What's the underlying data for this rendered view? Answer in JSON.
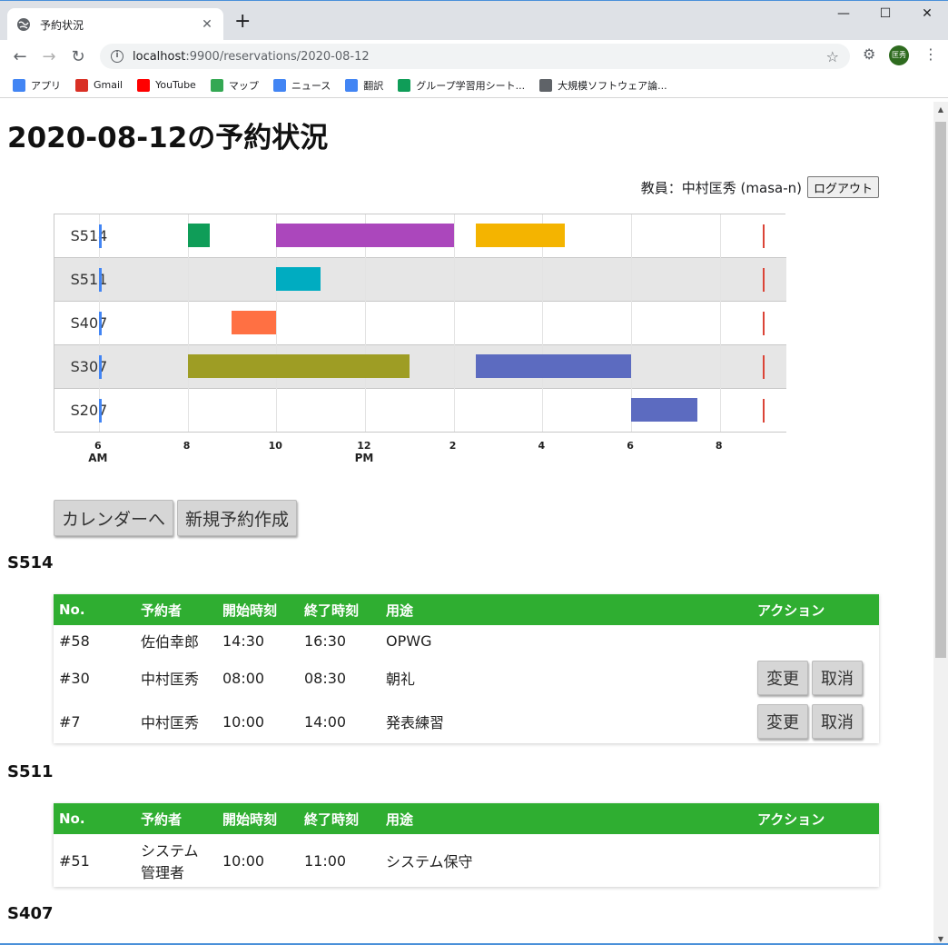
{
  "browser": {
    "tab_title": "予約状況",
    "tab_close": "✕",
    "new_tab": "+",
    "url_host": "localhost",
    "url_path": ":9900/reservations/2020-08-12",
    "avatar_text": "匡秀",
    "bookmarks": [
      {
        "label": "アプリ",
        "icon": "apps-grid-icon",
        "color": "#4285f4"
      },
      {
        "label": "Gmail",
        "icon": "gmail-icon",
        "color": "#d93025"
      },
      {
        "label": "YouTube",
        "icon": "youtube-icon",
        "color": "#ff0000"
      },
      {
        "label": "マップ",
        "icon": "maps-icon",
        "color": "#34a853"
      },
      {
        "label": "ニュース",
        "icon": "news-icon",
        "color": "#4285f4"
      },
      {
        "label": "翻訳",
        "icon": "translate-icon",
        "color": "#4285f4"
      },
      {
        "label": "グループ学習用シート...",
        "icon": "sheets-icon",
        "color": "#0f9d58"
      },
      {
        "label": "大規模ソフトウェア論...",
        "icon": "globe-icon",
        "color": "#5f6368"
      }
    ]
  },
  "page": {
    "title": "2020-08-12の予約状況",
    "user_label": "教員：",
    "user_name": "中村匡秀 (masa-n)",
    "logout": "ログアウト",
    "buttons": {
      "calendar": "カレンダーへ",
      "new_reservation": "新規予約作成"
    }
  },
  "timeline": {
    "type": "timeline",
    "x_range_hours": [
      5.0,
      21.5
    ],
    "rows": [
      {
        "room": "S514",
        "bars": [
          {
            "start": 8.0,
            "end": 8.5,
            "color": "#0f9d58"
          },
          {
            "start": 10.0,
            "end": 14.0,
            "color": "#ab47bc"
          },
          {
            "start": 14.5,
            "end": 16.5,
            "color": "#f4b400"
          }
        ]
      },
      {
        "room": "S511",
        "bars": [
          {
            "start": 10.0,
            "end": 11.0,
            "color": "#00acc1"
          }
        ]
      },
      {
        "room": "S407",
        "bars": [
          {
            "start": 9.0,
            "end": 10.0,
            "color": "#ff7043"
          }
        ]
      },
      {
        "room": "S307",
        "bars": [
          {
            "start": 8.0,
            "end": 13.0,
            "color": "#9e9d24"
          },
          {
            "start": 14.5,
            "end": 18.0,
            "color": "#5c6bc0"
          }
        ]
      },
      {
        "room": "S207",
        "bars": [
          {
            "start": 18.0,
            "end": 19.5,
            "color": "#5c6bc0"
          }
        ]
      }
    ],
    "ticks": [
      {
        "hour": 6,
        "label": "6",
        "sub": "AM"
      },
      {
        "hour": 8,
        "label": "8",
        "sub": ""
      },
      {
        "hour": 10,
        "label": "10",
        "sub": ""
      },
      {
        "hour": 12,
        "label": "12",
        "sub": "PM"
      },
      {
        "hour": 14,
        "label": "2",
        "sub": ""
      },
      {
        "hour": 16,
        "label": "4",
        "sub": ""
      },
      {
        "hour": 18,
        "label": "6",
        "sub": ""
      },
      {
        "hour": 20,
        "label": "8",
        "sub": ""
      }
    ],
    "start_marker_hour": 6.0,
    "end_marker_hour": 21.0
  },
  "table_headers": [
    "No.",
    "予約者",
    "開始時刻",
    "終了時刻",
    "用途",
    "アクション"
  ],
  "sections": [
    {
      "room": "S514",
      "rows": [
        {
          "no": "#58",
          "user": "佐伯幸郎",
          "start": "14:30",
          "end": "16:30",
          "purpose": "OPWG",
          "actions": false
        },
        {
          "no": "#30",
          "user": "中村匡秀",
          "start": "08:00",
          "end": "08:30",
          "purpose": "朝礼",
          "actions": true
        },
        {
          "no": "#7",
          "user": "中村匡秀",
          "start": "10:00",
          "end": "14:00",
          "purpose": "発表練習",
          "actions": true
        }
      ]
    },
    {
      "room": "S511",
      "rows": [
        {
          "no": "#51",
          "user": "システム管理者",
          "start": "10:00",
          "end": "11:00",
          "purpose": "システム保守",
          "actions": false
        }
      ]
    },
    {
      "room": "S407",
      "rows": []
    }
  ],
  "action_labels": {
    "edit": "変更",
    "cancel": "取消"
  }
}
